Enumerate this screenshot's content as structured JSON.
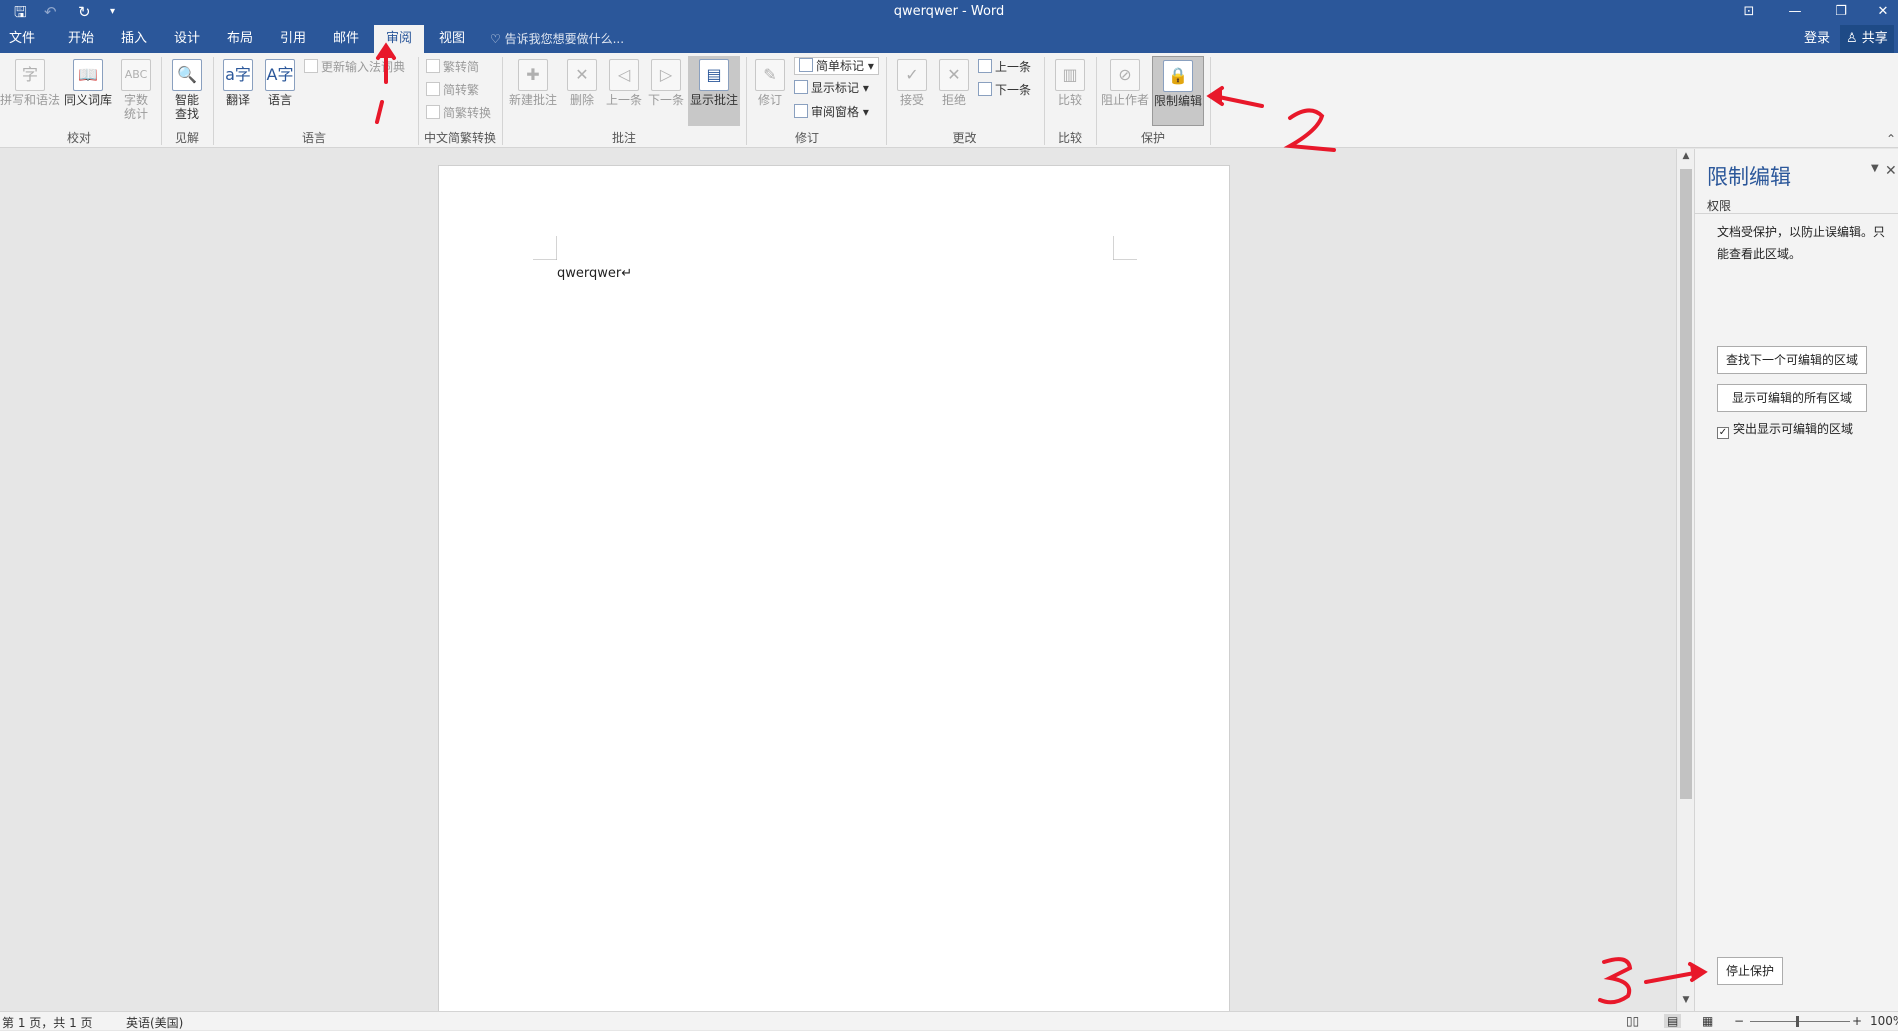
{
  "window": {
    "title": "qwerqwer - Word"
  },
  "quick_access": {
    "save_icon": "save-icon",
    "undo_icon": "undo-icon",
    "redo_icon": "redo-icon",
    "customize_icon": "dropdown-icon"
  },
  "window_controls": {
    "ribbon_display": "⊡",
    "minimize": "—",
    "restore": "❐",
    "close": "✕"
  },
  "tabs": [
    "文件",
    "开始",
    "插入",
    "设计",
    "布局",
    "引用",
    "邮件",
    "审阅",
    "视图"
  ],
  "active_tab": "审阅",
  "tell_me": "♡ 告诉我您想要做什么...",
  "sign_in": "登录",
  "share": "♙ 共享",
  "ribbon": {
    "proofing": {
      "spell": "拼写和语法",
      "thesaurus": "同义词库",
      "wordcount": [
        "字数",
        "统计"
      ],
      "group": "校对"
    },
    "insights": {
      "smart_lookup": [
        "智能",
        "查找"
      ],
      "group": "见解"
    },
    "language": {
      "translate": "翻译",
      "language": "语言",
      "ime_dict": "更新输入法词典",
      "group": "语言"
    },
    "chinese": {
      "t2s": "繁转简",
      "s2t": "简转繁",
      "convert": "简繁转换",
      "group": "中文简繁转换"
    },
    "comments": {
      "new": "新建批注",
      "delete": "删除",
      "prev": "上一条",
      "next": "下一条",
      "show": "显示批注",
      "group": "批注"
    },
    "tracking": {
      "track": "修订",
      "markup": "简单标记",
      "show_markup": "显示标记",
      "pane": "审阅窗格",
      "group": "修订"
    },
    "changes": {
      "accept": "接受",
      "reject": "拒绝",
      "prev": "上一条",
      "next": "下一条",
      "group": "更改"
    },
    "compare": {
      "compare": "比较",
      "group": "比较"
    },
    "protect": {
      "block": "阻止作者",
      "restrict": "限制编辑",
      "group": "保护"
    }
  },
  "document": {
    "text": "qwerqwer↵"
  },
  "pane": {
    "title": "限制编辑",
    "section": "权限",
    "message": "文档受保护，以防止误编辑。只能查看此区域。",
    "find_next": "查找下一个可编辑的区域",
    "show_all": "显示可编辑的所有区域",
    "highlight": "突出显示可编辑的区域",
    "highlight_checked": true,
    "stop": "停止保护"
  },
  "status": {
    "page": "第 1 页，共 1 页",
    "lang": "英语(美国)",
    "zoom": "100%"
  },
  "annotations": {
    "color": "#e8182a",
    "labels": [
      "1",
      "2",
      "3"
    ]
  }
}
